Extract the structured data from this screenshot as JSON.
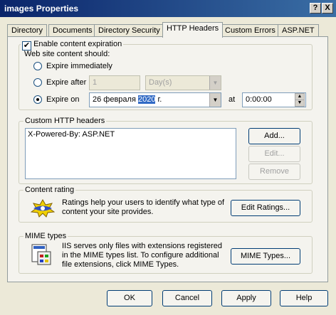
{
  "window": {
    "title": "images Properties",
    "help_btn": "?",
    "close_btn": "X"
  },
  "tabs": [
    {
      "label": "Directory"
    },
    {
      "label": "Documents"
    },
    {
      "label": "Directory Security"
    },
    {
      "label": "HTTP Headers"
    },
    {
      "label": "Custom Errors"
    },
    {
      "label": "ASP.NET"
    }
  ],
  "expiration": {
    "enable_label": "Enable content expiration",
    "enable_checked": true,
    "prompt": "Web site content should:",
    "immediately_label": "Expire immediately",
    "after_label": "Expire after",
    "after_value": "1",
    "after_unit": "Day(s)",
    "on_label": "Expire on",
    "date_prefix": "26 февраля ",
    "date_year": "2020",
    "date_suffix": " г.",
    "at_label": "at",
    "time_value": "0:00:00",
    "selected": "on"
  },
  "custom_headers": {
    "legend": "Custom HTTP headers",
    "items": [
      "X-Powered-By: ASP.NET"
    ],
    "add_label": "Add...",
    "edit_label": "Edit...",
    "remove_label": "Remove"
  },
  "content_rating": {
    "legend": "Content rating",
    "text_line1": "Ratings help your users to identify what type of",
    "text_line2": "content your site provides.",
    "edit_ratings_label": "Edit Ratings..."
  },
  "mime": {
    "legend": "MIME types",
    "text_line1": "IIS serves only files with extensions registered",
    "text_line2": "in the MIME types list. To configure additional",
    "text_line3": "file extensions, click MIME Types.",
    "button_label": "MIME Types..."
  },
  "footer": {
    "ok": "OK",
    "cancel": "Cancel",
    "apply": "Apply",
    "help": "Help"
  }
}
